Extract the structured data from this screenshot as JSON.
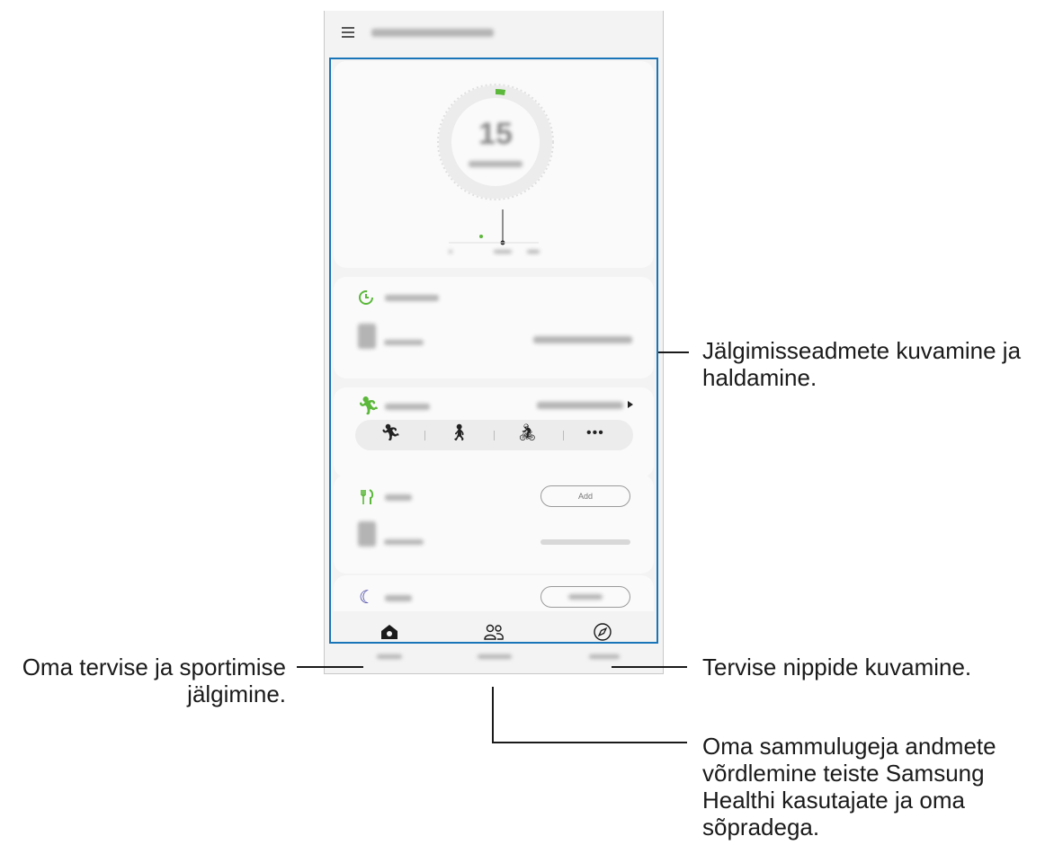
{
  "annotations": {
    "tracker": "Jälgimisseadmete kuvamine ja haldamine.",
    "home": "Oma tervise ja sportimise jälgimine.",
    "discover": "Tervise nippide kuvamine.",
    "together": "Oma sammulugeja andmete võrdlemine teiste Samsung Healthi kasutajate ja oma sõpradega."
  },
  "steps": {
    "value": "15",
    "progress": 0.03
  },
  "food": {
    "add_label": "Add"
  },
  "icons": {
    "menu": "menu-icon",
    "timer": "timer-icon",
    "run": "running-icon",
    "walk": "walking-icon",
    "bike": "cycling-icon",
    "more": "more-icon",
    "food": "fork-knife-icon",
    "sleep": "moon-icon",
    "home": "home-icon",
    "together": "people-icon",
    "discover": "compass-icon"
  },
  "colors": {
    "accent_green": "#5bb83a",
    "frame_blue": "#1a75b8",
    "sleep_blue": "#3a3aa0"
  }
}
